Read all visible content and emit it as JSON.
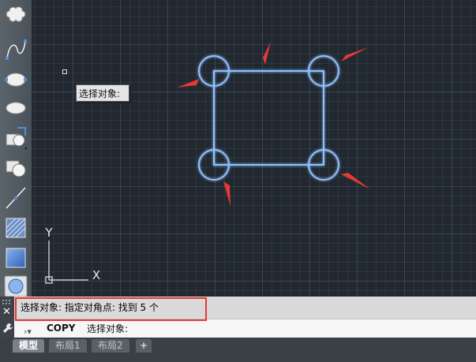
{
  "toolbar": {
    "tools": [
      {
        "icon": "revcloud-icon"
      },
      {
        "icon": "spline-icon"
      },
      {
        "icon": "ellipse-icon"
      },
      {
        "icon": "ellipse-arc-icon"
      },
      {
        "icon": "insert-block-icon"
      },
      {
        "icon": "make-block-icon"
      },
      {
        "icon": "construction-line-icon"
      },
      {
        "icon": "hatch-icon"
      },
      {
        "icon": "gradient-icon"
      },
      {
        "icon": "region-icon"
      }
    ]
  },
  "canvas": {
    "tooltip_text": "选择对象:",
    "ucs": {
      "y_label": "Y",
      "x_label": "X"
    },
    "colors": {
      "selection": "#7eb3ff",
      "arrow": "#e53935"
    }
  },
  "command": {
    "history_line": "选择对象: 指定对角点: 找到 5 个",
    "current_command": "COPY",
    "input_value": "选择对象:",
    "close_label": "✕"
  },
  "tabs": {
    "model": "模型",
    "layout1": "布局1",
    "layout2": "布局2",
    "add": "+"
  }
}
